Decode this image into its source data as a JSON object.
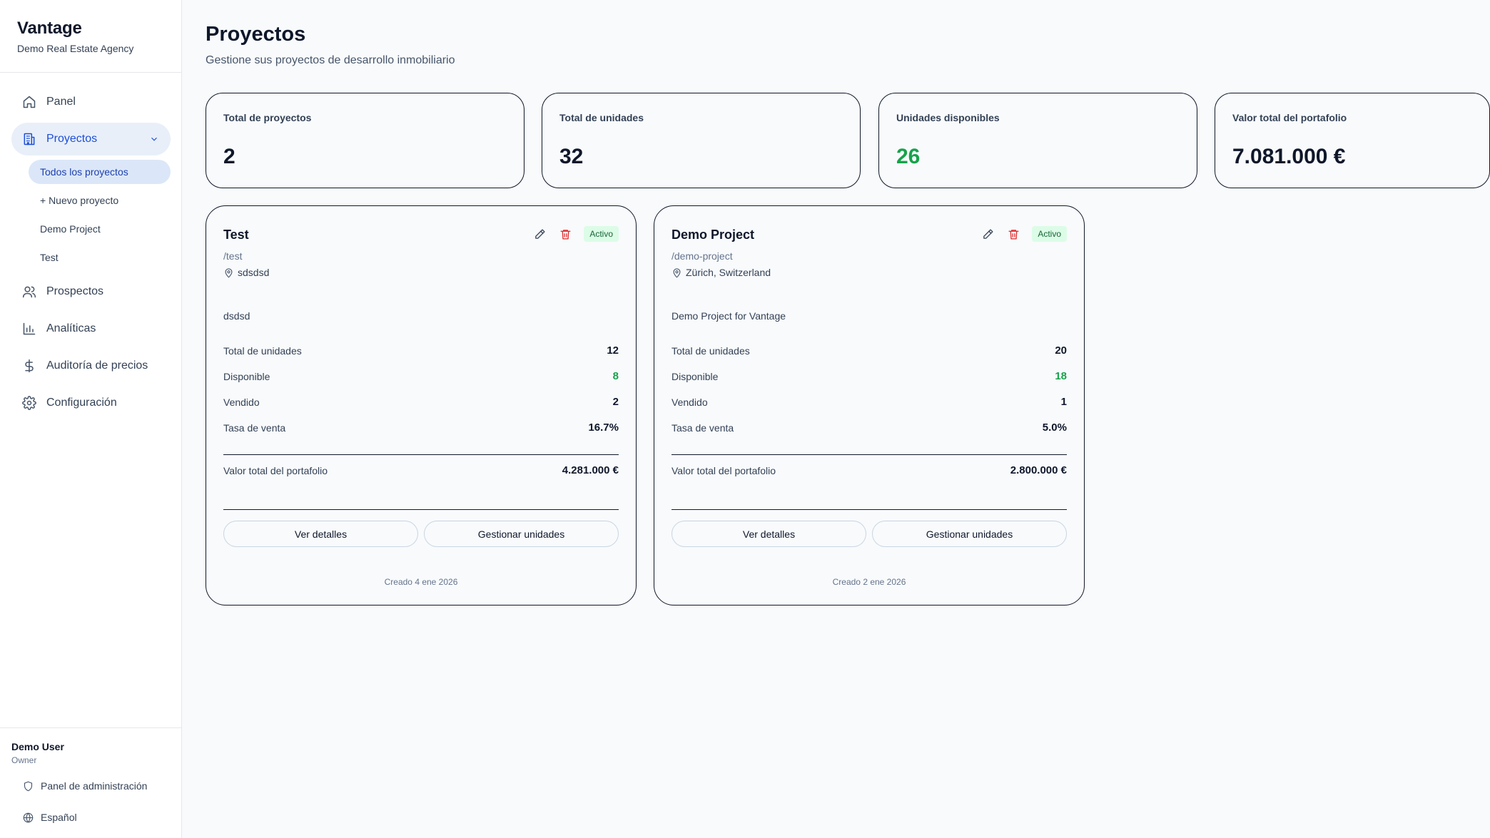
{
  "app": {
    "title": "Vantage",
    "agency": "Demo Real Estate Agency"
  },
  "nav": {
    "panel": "Panel",
    "projects": "Proyectos",
    "projects_sub": [
      "Todos los proyectos",
      "+ Nuevo proyecto",
      "Demo Project",
      "Test"
    ],
    "prospects": "Prospectos",
    "analytics": "Analíticas",
    "price_audit": "Auditoría de precios",
    "settings": "Configuración"
  },
  "user": {
    "name": "Demo User",
    "role": "Owner"
  },
  "footer": {
    "admin_panel": "Panel de administración",
    "language": "Español"
  },
  "page": {
    "title": "Proyectos",
    "subtitle": "Gestione sus proyectos de desarrollo inmobiliario"
  },
  "stats": [
    {
      "label": "Total de proyectos",
      "value": "2"
    },
    {
      "label": "Total de unidades",
      "value": "32"
    },
    {
      "label": "Unidades disponibles",
      "value": "26"
    },
    {
      "label": "Valor total del portafolio",
      "value": "7.081.000 €"
    }
  ],
  "labels": {
    "total_units": "Total de unidades",
    "available": "Disponible",
    "sold": "Vendido",
    "sale_rate": "Tasa de venta",
    "portfolio_value": "Valor total del portafolio",
    "view_details": "Ver detalles",
    "manage_units": "Gestionar unidades"
  },
  "projects": [
    {
      "name": "Test",
      "slug": "/test",
      "location": "sdsdsd",
      "description": "dsdsd",
      "status": "Activo",
      "total_units": "12",
      "available": "8",
      "sold": "2",
      "sale_rate": "16.7%",
      "portfolio_value": "4.281.000 €",
      "created": "Creado 4 ene 2026"
    },
    {
      "name": "Demo Project",
      "slug": "/demo-project",
      "location": "Zürich, Switzerland",
      "description": "Demo Project for Vantage",
      "status": "Activo",
      "total_units": "20",
      "available": "18",
      "sold": "1",
      "sale_rate": "5.0%",
      "portfolio_value": "2.800.000 €",
      "created": "Creado 2 ene 2026"
    }
  ],
  "colors": {
    "accent": "#1d4ed8",
    "active_bg": "#e8eff9",
    "green": "#16a34a",
    "danger": "#dc2626"
  }
}
